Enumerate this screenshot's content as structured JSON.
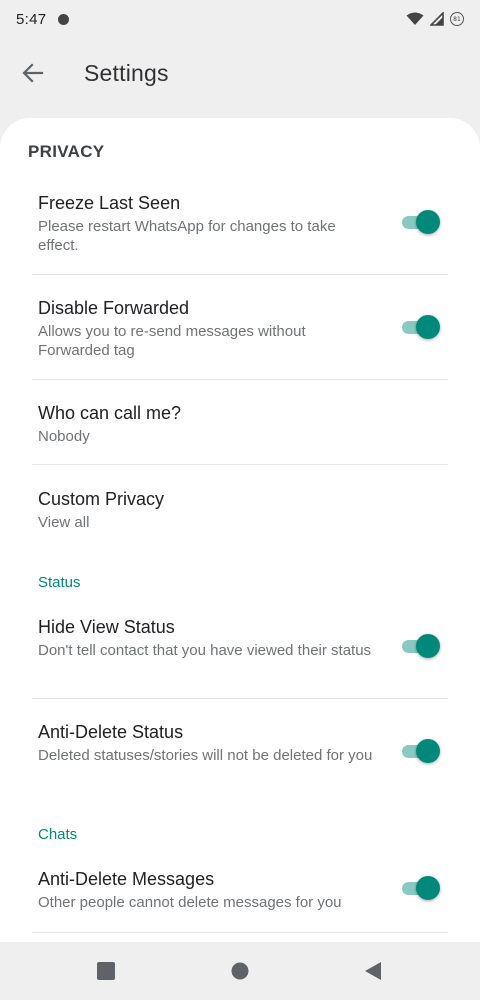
{
  "status_bar": {
    "time": "5:47",
    "battery_level": "81"
  },
  "app_bar": {
    "title": "Settings"
  },
  "sections": {
    "privacy_header": "PRIVACY",
    "status_category": "Status",
    "chats_category": "Chats"
  },
  "prefs": [
    {
      "title": "Freeze Last Seen",
      "summary": "Please restart WhatsApp for changes to take effect.",
      "toggle": true,
      "checked": true
    },
    {
      "title": "Disable Forwarded",
      "summary": "Allows you to re-send messages without Forwarded tag",
      "toggle": true,
      "checked": true
    },
    {
      "title": "Who can call me?",
      "summary": "Nobody",
      "toggle": false
    },
    {
      "title": "Custom Privacy",
      "summary": "View all",
      "toggle": false
    },
    {
      "title": "Hide View Status",
      "summary": "Don't tell contact that you have viewed their status",
      "toggle": true,
      "checked": true
    },
    {
      "title": "Anti-Delete Status",
      "summary": "Deleted statuses/stories will not be deleted for you",
      "toggle": true,
      "checked": true
    },
    {
      "title": "Anti-Delete Messages",
      "summary": "Other people cannot delete messages for you",
      "toggle": true,
      "checked": true
    }
  ],
  "colors": {
    "accent": "#00897b",
    "track": "#8ac9c1",
    "background": "#efefef",
    "card": "#ffffff"
  },
  "icons": [
    "wifi-icon",
    "signal-icon",
    "battery-icon",
    "jio-icon",
    "back-arrow-icon",
    "recents-icon",
    "home-icon",
    "back-nav-icon"
  ]
}
